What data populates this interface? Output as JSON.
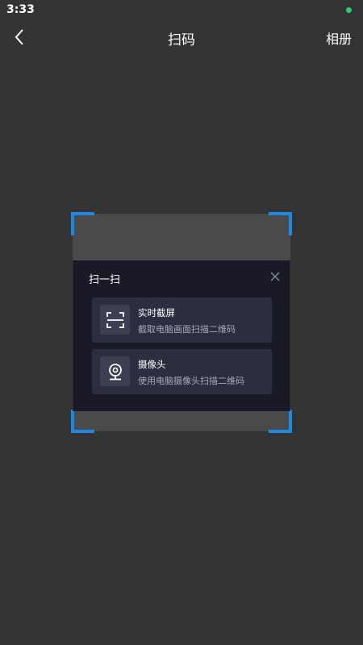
{
  "status_bar": {
    "time": "3:33",
    "indicator_color": "#2ecc71"
  },
  "header": {
    "title": "扫码",
    "back_icon": "chevron-left-icon",
    "right_action": "相册"
  },
  "scanner": {
    "corner_color": "#1e88e5"
  },
  "dialog": {
    "title": "扫一扫",
    "close_icon": "close-icon",
    "options": [
      {
        "icon": "screen-capture-icon",
        "title": "实时截屏",
        "description": "截取电脑画面扫描二维码"
      },
      {
        "icon": "webcam-icon",
        "title": "摄像头",
        "description": "使用电脑摄像头扫描二维码"
      }
    ]
  }
}
